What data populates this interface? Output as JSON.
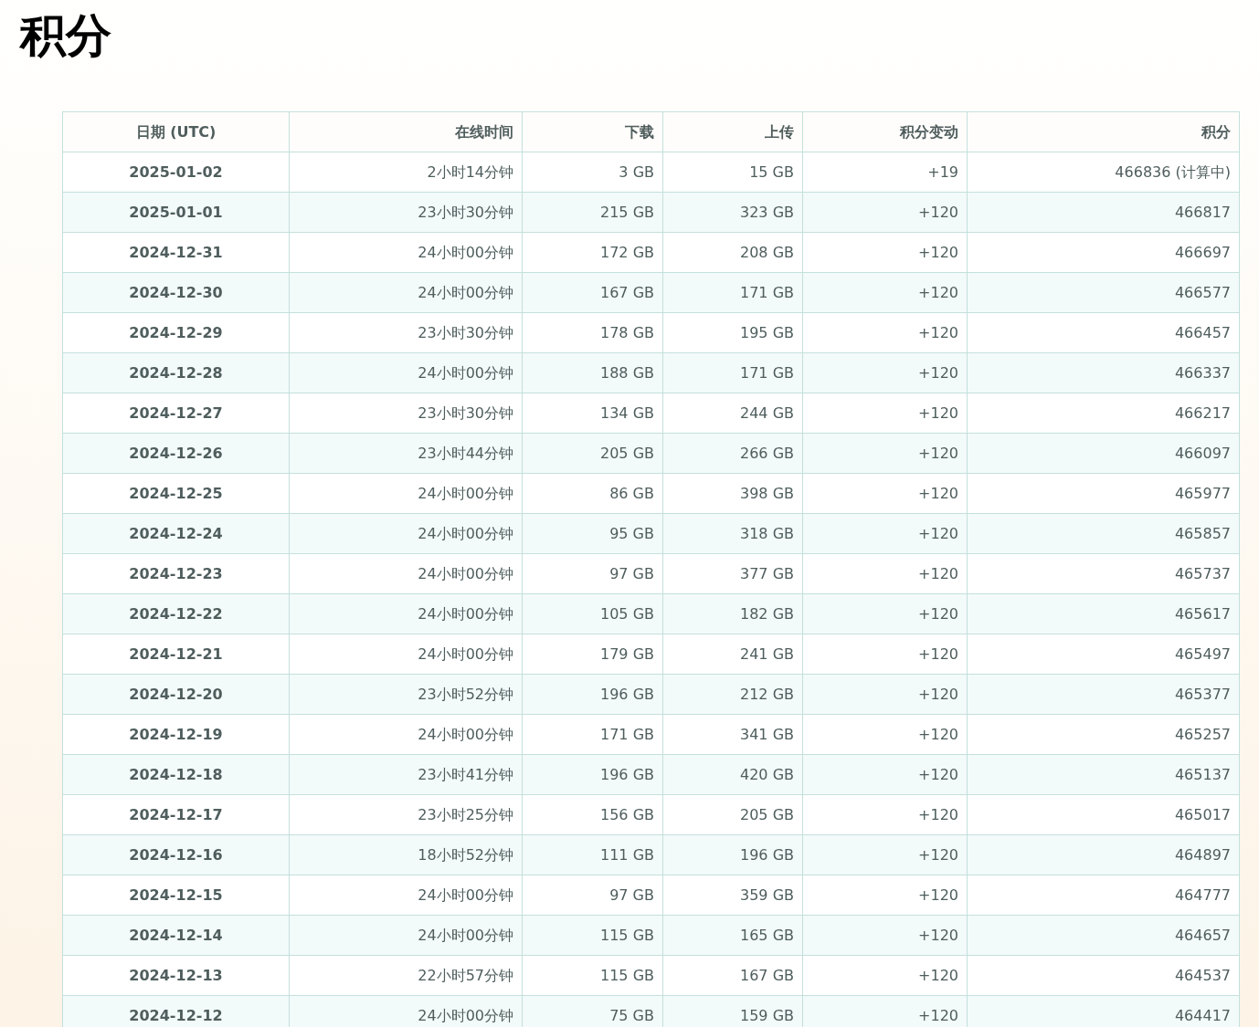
{
  "page": {
    "title": "积分"
  },
  "table": {
    "columns": [
      "日期 (UTC)",
      "在线时间",
      "下载",
      "上传",
      "积分变动",
      "积分"
    ],
    "rows": [
      [
        "2025-01-02",
        "2小时14分钟",
        "3 GB",
        "15 GB",
        "+19",
        "466836 (计算中)"
      ],
      [
        "2025-01-01",
        "23小时30分钟",
        "215 GB",
        "323 GB",
        "+120",
        "466817"
      ],
      [
        "2024-12-31",
        "24小时00分钟",
        "172 GB",
        "208 GB",
        "+120",
        "466697"
      ],
      [
        "2024-12-30",
        "24小时00分钟",
        "167 GB",
        "171 GB",
        "+120",
        "466577"
      ],
      [
        "2024-12-29",
        "23小时30分钟",
        "178 GB",
        "195 GB",
        "+120",
        "466457"
      ],
      [
        "2024-12-28",
        "24小时00分钟",
        "188 GB",
        "171 GB",
        "+120",
        "466337"
      ],
      [
        "2024-12-27",
        "23小时30分钟",
        "134 GB",
        "244 GB",
        "+120",
        "466217"
      ],
      [
        "2024-12-26",
        "23小时44分钟",
        "205 GB",
        "266 GB",
        "+120",
        "466097"
      ],
      [
        "2024-12-25",
        "24小时00分钟",
        "86 GB",
        "398 GB",
        "+120",
        "465977"
      ],
      [
        "2024-12-24",
        "24小时00分钟",
        "95 GB",
        "318 GB",
        "+120",
        "465857"
      ],
      [
        "2024-12-23",
        "24小时00分钟",
        "97 GB",
        "377 GB",
        "+120",
        "465737"
      ],
      [
        "2024-12-22",
        "24小时00分钟",
        "105 GB",
        "182 GB",
        "+120",
        "465617"
      ],
      [
        "2024-12-21",
        "24小时00分钟",
        "179 GB",
        "241 GB",
        "+120",
        "465497"
      ],
      [
        "2024-12-20",
        "23小时52分钟",
        "196 GB",
        "212 GB",
        "+120",
        "465377"
      ],
      [
        "2024-12-19",
        "24小时00分钟",
        "171 GB",
        "341 GB",
        "+120",
        "465257"
      ],
      [
        "2024-12-18",
        "23小时41分钟",
        "196 GB",
        "420 GB",
        "+120",
        "465137"
      ],
      [
        "2024-12-17",
        "23小时25分钟",
        "156 GB",
        "205 GB",
        "+120",
        "465017"
      ],
      [
        "2024-12-16",
        "18小时52分钟",
        "111 GB",
        "196 GB",
        "+120",
        "464897"
      ],
      [
        "2024-12-15",
        "24小时00分钟",
        "97 GB",
        "359 GB",
        "+120",
        "464777"
      ],
      [
        "2024-12-14",
        "24小时00分钟",
        "115 GB",
        "165 GB",
        "+120",
        "464657"
      ],
      [
        "2024-12-13",
        "22小时57分钟",
        "115 GB",
        "167 GB",
        "+120",
        "464537"
      ],
      [
        "2024-12-12",
        "24小时00分钟",
        "75 GB",
        "159 GB",
        "+120",
        "464417"
      ]
    ]
  }
}
